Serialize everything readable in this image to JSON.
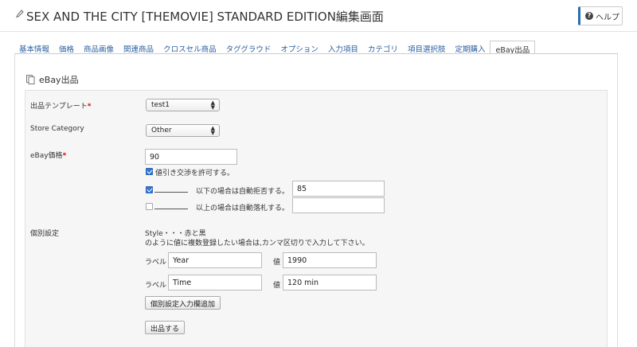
{
  "header": {
    "title": "SEX AND THE CITY [THEMOVIE] STANDARD EDITION編集画面",
    "help_label": "ヘルプ"
  },
  "tabs": [
    {
      "label": "基本情報",
      "active": false
    },
    {
      "label": "価格",
      "active": false
    },
    {
      "label": "商品画像",
      "active": false
    },
    {
      "label": "関連商品",
      "active": false
    },
    {
      "label": "クロスセル商品",
      "active": false
    },
    {
      "label": "タググラウド",
      "active": false
    },
    {
      "label": "オプション",
      "active": false
    },
    {
      "label": "入力項目",
      "active": false
    },
    {
      "label": "カテゴリ",
      "active": false
    },
    {
      "label": "項目選択肢",
      "active": false
    },
    {
      "label": "定期購入",
      "active": false
    },
    {
      "label": "eBay出品",
      "active": true
    }
  ],
  "section": {
    "title": "eBay出品"
  },
  "form": {
    "template": {
      "label": "出品テンプレート",
      "required_mark": "*",
      "value": "test1"
    },
    "store_category": {
      "label": "Store Category",
      "value": "Other"
    },
    "price": {
      "label": "eBay価格",
      "required_mark": "*",
      "value": "90",
      "best_offer": {
        "checked": true,
        "label": "値引き交渉を許可する。"
      },
      "auto_decline": {
        "checked": true,
        "label": "以下の場合は自動拒否する。",
        "value": "85"
      },
      "auto_accept": {
        "checked": false,
        "label": "以上の場合は自動落札する。",
        "value": ""
      }
    },
    "item_specifics": {
      "label": "個別設定",
      "help_line1": "Style・・・赤と黒",
      "help_line2": "のように値に複数登録したい場合は,カンマ区切りで入力して下さい。",
      "label_caption": "ラベル",
      "value_caption": "値",
      "rows": [
        {
          "label": "Year",
          "value": "1990"
        },
        {
          "label": "Time",
          "value": "120 min"
        }
      ],
      "add_button": "個別設定入力欄追加"
    },
    "submit_button": "出品する"
  },
  "colors": {
    "link": "#2b5fa0",
    "required": "#dd0000",
    "checkbox": "#3478d4"
  }
}
